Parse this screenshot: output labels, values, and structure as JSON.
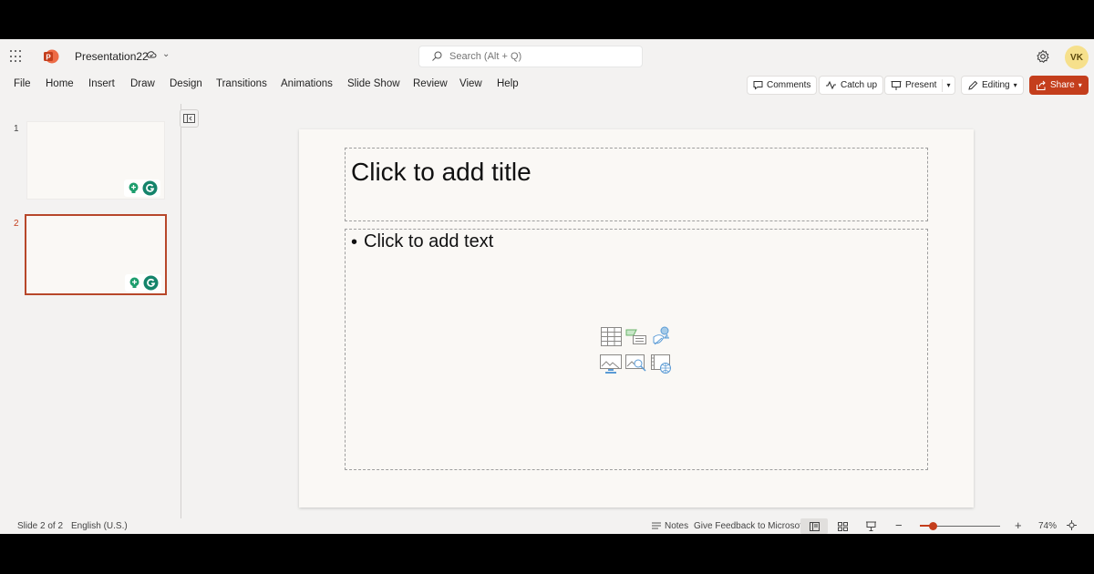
{
  "titlebar": {
    "doc_title": "Presentation22",
    "search_placeholder": "Search (Alt + Q)",
    "avatar_initials": "VK"
  },
  "menu": {
    "tabs": [
      "File",
      "Home",
      "Insert",
      "Draw",
      "Design",
      "Transitions",
      "Animations",
      "Slide Show",
      "Review",
      "View",
      "Help"
    ],
    "buttons": {
      "comments": "Comments",
      "catch_up": "Catch up",
      "present": "Present",
      "editing": "Editing",
      "share": "Share"
    }
  },
  "thumbnails": [
    {
      "number": "1",
      "active": false
    },
    {
      "number": "2",
      "active": true
    }
  ],
  "slide": {
    "title_placeholder": "Click to add title",
    "body_bullet": "•",
    "body_placeholder": "Click to add text",
    "insert_icons": [
      "table-icon",
      "chart-icon",
      "smartart-icon",
      "picture-icon",
      "stock-images-icon",
      "video-icon"
    ]
  },
  "status": {
    "slide_info": "Slide 2 of 2",
    "language": "English (U.S.)",
    "notes": "Notes",
    "feedback": "Give Feedback to Microsoft",
    "zoom_minus": "−",
    "zoom_plus": "+",
    "zoom": "74%"
  },
  "colors": {
    "accent": "#c43e1c",
    "app_bg": "#f3f2f1",
    "slide_bg": "#faf8f5"
  }
}
